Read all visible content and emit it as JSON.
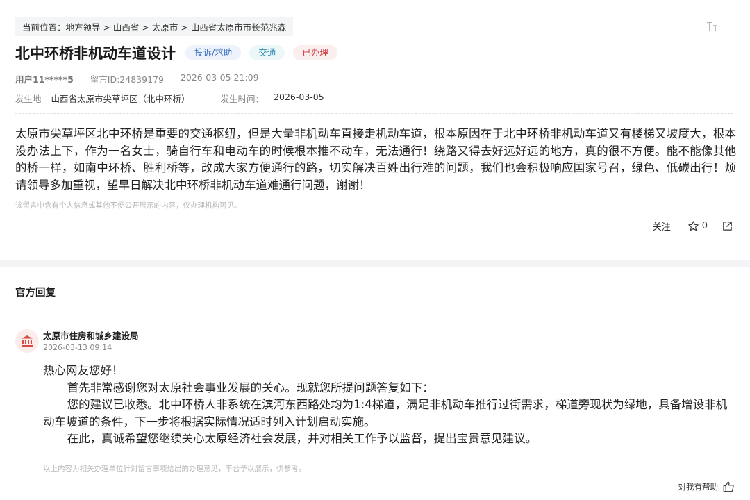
{
  "breadcrumb": "当前位置：地方领导 > 山西省 > 太原市 > 山西省太原市市长范兆森",
  "font_size_icon_name": "text-size-icon",
  "title": "北中环桥非机动车道设计",
  "tags": [
    {
      "label": "投诉/求助",
      "color": "#3b6fc2"
    },
    {
      "label": "交通",
      "color": "#2d8cb0"
    },
    {
      "label": "已办理",
      "color": "#d0393c"
    }
  ],
  "meta": {
    "user": "用户11*****5",
    "message_id": "留言ID:24839179",
    "datetime": "2026-03-05 21:09"
  },
  "place": {
    "location_label": "发生地",
    "location_value": "山西省太原市尖草坪区（北中环桥）",
    "time_label": "发生时间：",
    "time_value": "2026-03-05"
  },
  "message_body": "太原市尖草坪区北中环桥是重要的交通枢纽，但是大量非机动车直接走机动车道，根本原因在于北中环桥非机动车道又有楼梯又坡度大，根本没办法上下，作为一名女士，骑自行车和电动车的时候根本推不动车，无法通行！绕路又得去好远好远的地方，真的很不方便。能不能像其他的桥一样，如南中环桥、胜利桥等，改成大家方便通行的路，切实解决百姓出行难的问题，我们也会积极响应国家号召，绿色、低碳出行！烦请领导多加重视，望早日解决北中环桥非机动车道难通行问题，谢谢！",
  "privacy_note": "该留言中含有个人信息或其他不便公开展示的内容，仅办理机构可见。",
  "actions": {
    "follow_label": "关注",
    "star_count": "0"
  },
  "reply_section": {
    "heading": "官方回复",
    "org_name": "太原市住房和城乡建设局",
    "date": "2026-03-13 09:14",
    "greeting": "热心网友您好！",
    "paragraphs": [
      "首先非常感谢您对太原社会事业发展的关心。现就您所提问题答复如下：",
      "您的建议已收悉。北中环桥人非系统在滨河东西路处均为1:4梯道，满足非机动车推行过街需求，梯道旁现状为绿地，具备增设非机动车坡道的条件，下一步将根据实际情况适时列入计划启动实施。",
      "在此，真诚希望您继续关心太原经济社会发展，并对相关工作予以监督，提出宝贵意见建议。"
    ],
    "disclaimer": "以上内容为相关办理单位针对留言事项给出的办理意见，平台予以展示，供参考。",
    "helpful_label": "对我有帮助"
  }
}
